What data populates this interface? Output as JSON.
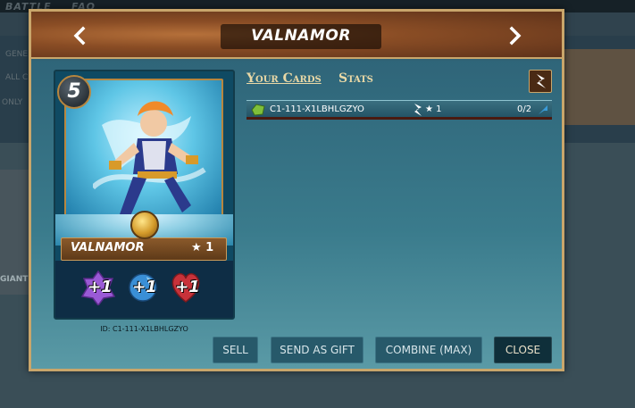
{
  "background": {
    "nav_left": "BATTLE",
    "nav_right": "FAQ",
    "filter_label_1": "GENE",
    "filter_label_2": "ALL C",
    "filter_label_3": "ONLY",
    "side_label": "GIANT"
  },
  "modal": {
    "title": "VALNAMOR",
    "prev_icon": "chevron-left-icon",
    "next_icon": "chevron-right-icon"
  },
  "card": {
    "mana": "5",
    "name": "VALNAMOR",
    "level": "★ 1",
    "stats": [
      {
        "name": "magic",
        "value": "+1",
        "color": "#9a5ad6"
      },
      {
        "name": "speed",
        "value": "+1",
        "color": "#3a8fd6"
      },
      {
        "name": "health",
        "value": "+1",
        "color": "#c8323a"
      }
    ],
    "id_text": "ID: C1-111-X1LBHLGZYO"
  },
  "tabs": [
    {
      "label": "Your Cards",
      "active": true
    },
    {
      "label": "Stats",
      "active": false
    }
  ],
  "cards_list": [
    {
      "id": "C1-111-X1LBHLGZYO",
      "level": "★ 1",
      "count": "0/2"
    }
  ],
  "buttons": {
    "sell": "SELL",
    "gift": "SEND AS GIFT",
    "combine": "COMBINE (MAX)",
    "close": "CLOSE"
  },
  "colors": {
    "frame_gold": "#c9a66b",
    "panel_teal": "#2f6579",
    "accent_cream": "#e9d8a6"
  }
}
